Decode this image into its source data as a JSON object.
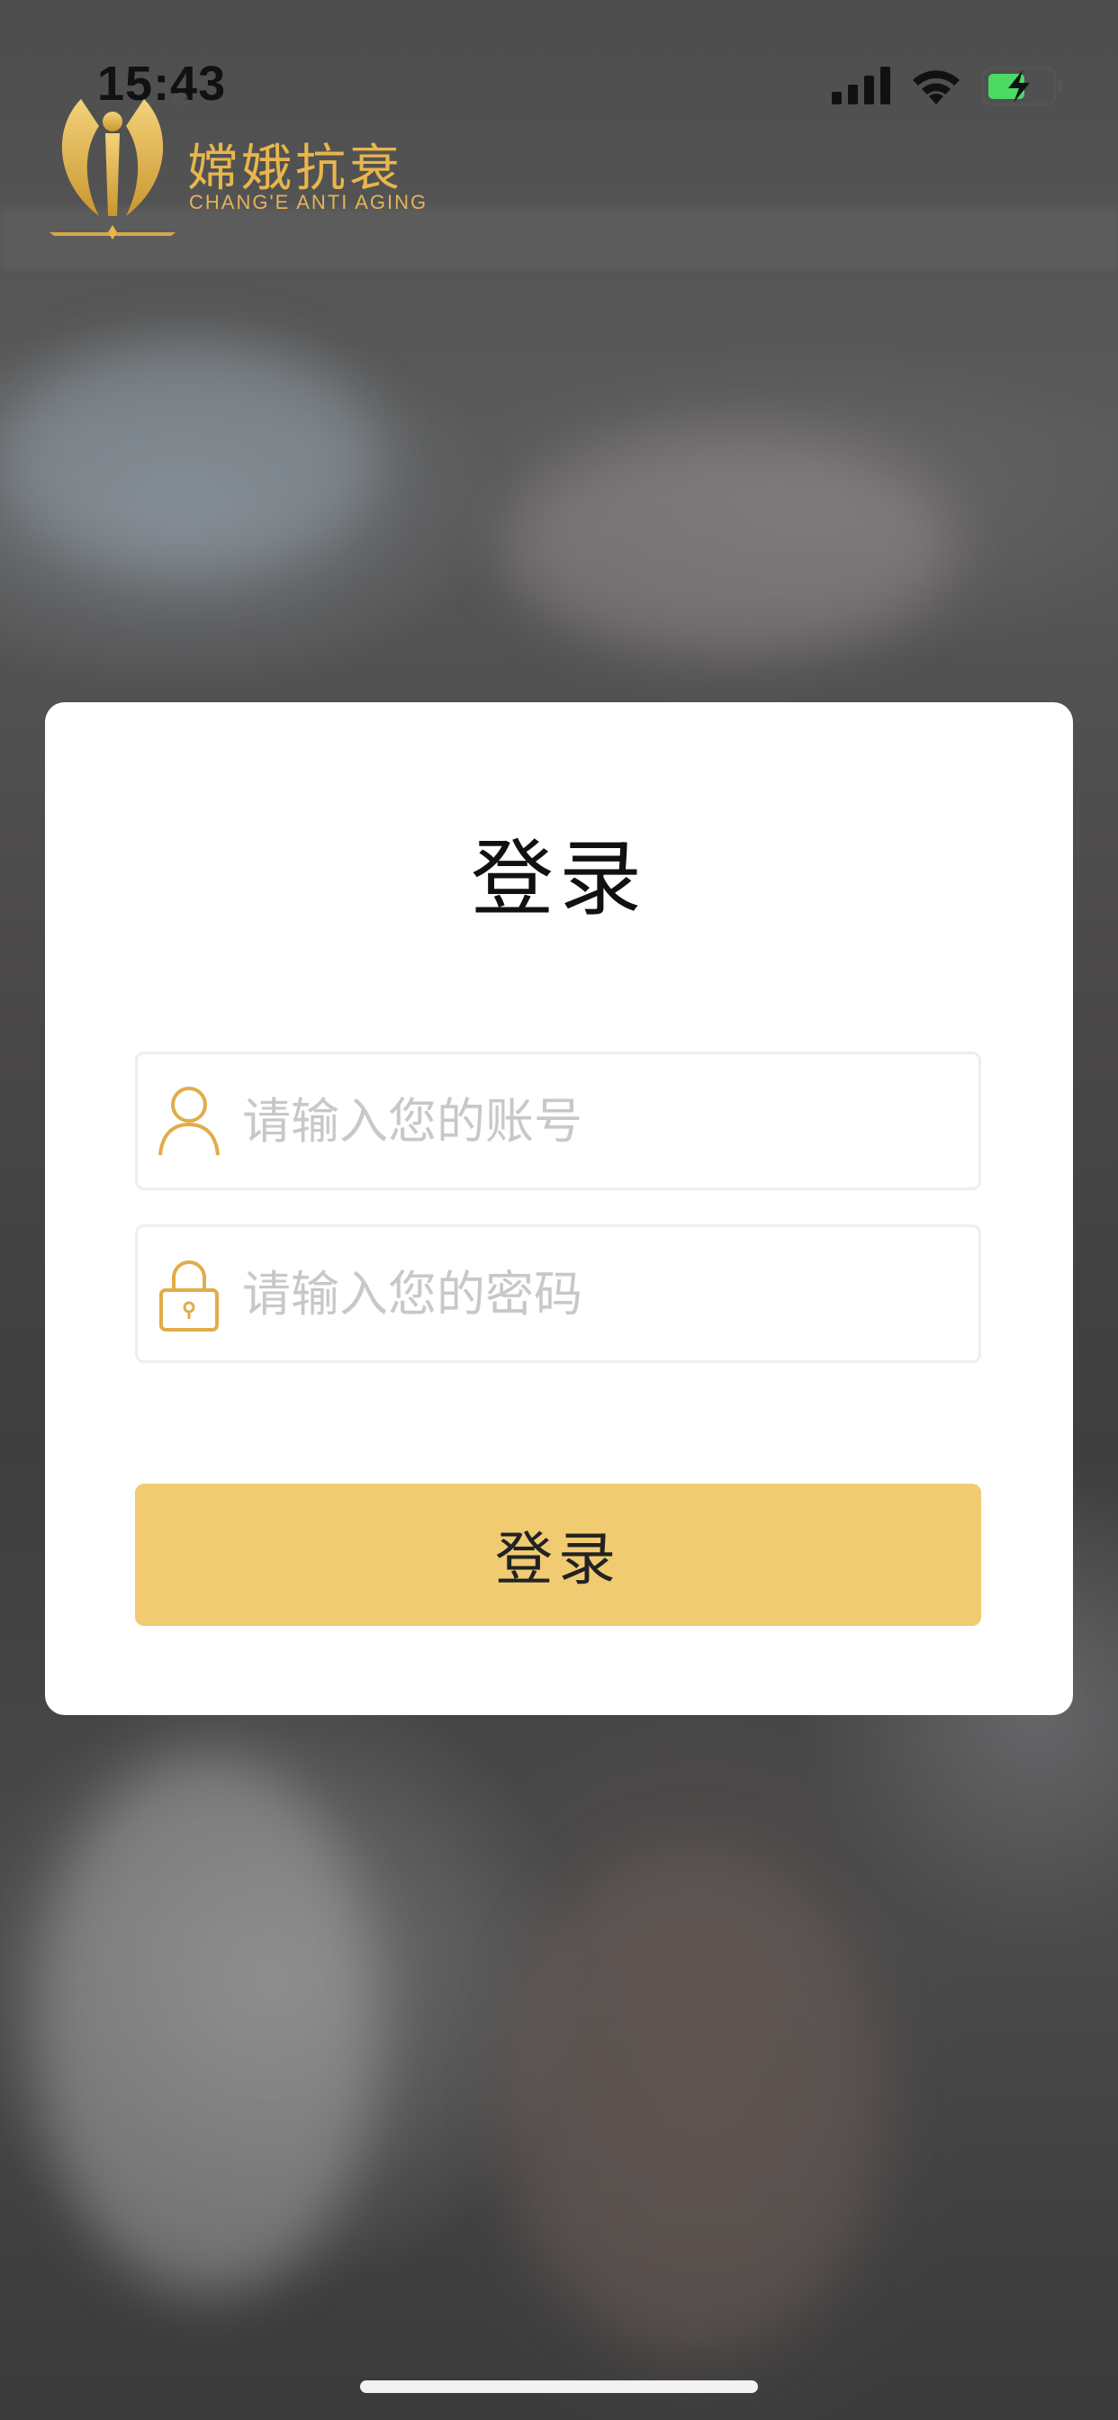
{
  "status_bar": {
    "time": "15:43",
    "signal_icon": "cellular-signal-icon",
    "wifi_icon": "wifi-icon",
    "battery_icon": "battery-charging-icon",
    "battery_color": "#4cd964"
  },
  "logo": {
    "name_cn": "嫦娥抗衰",
    "name_en": "CHANG'E ANTI AGING",
    "registered_mark": "®",
    "brand_color": "#e8b64c"
  },
  "login_card": {
    "title": "登录",
    "username_placeholder": "请输入您的账号",
    "password_placeholder": "请输入您的密码",
    "submit_label": "登录",
    "user_icon": "user-icon",
    "lock_icon": "lock-icon",
    "accent_color": "#f0cb72"
  }
}
